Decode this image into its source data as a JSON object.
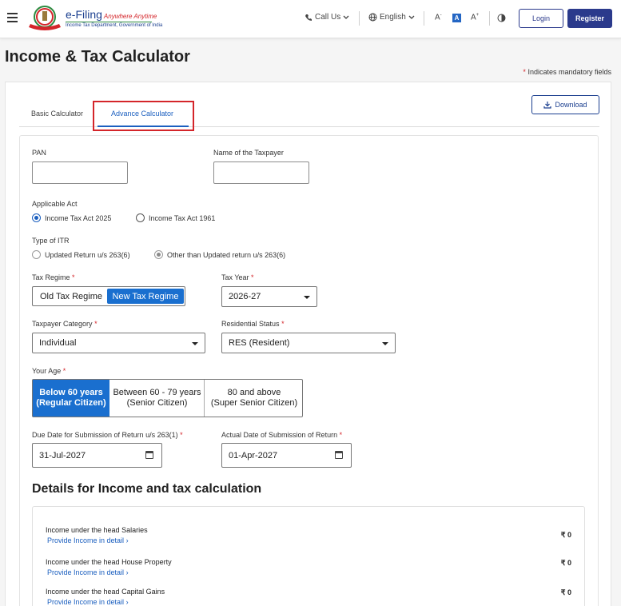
{
  "header": {
    "brand_main": "e-Filing",
    "brand_tag": "Anywhere Anytime",
    "brand_sub": "Income Tax Department, Government of India",
    "call_us": "Call Us",
    "language": "English",
    "font_small": "A",
    "font_normal": "A",
    "font_large": "A",
    "login": "Login",
    "register": "Register"
  },
  "page": {
    "title": "Income & Tax Calculator",
    "mandatory_star": "*",
    "mandatory_note": "Indicates mandatory fields",
    "download": "Download"
  },
  "tabs": [
    {
      "label": "Basic Calculator",
      "active": false
    },
    {
      "label": "Advance Calculator",
      "active": true
    }
  ],
  "form": {
    "pan_label": "PAN",
    "pan_value": "",
    "name_label": "Name of the Taxpayer",
    "name_value": "",
    "act_label": "Applicable Act",
    "act_options": [
      "Income Tax Act 2025",
      "Income Tax Act 1961"
    ],
    "act_selected": "Income Tax Act 2025",
    "itr_label": "Type of ITR",
    "itr_options": [
      "Updated Return u/s 263(6)",
      "Other than Updated return u/s 263(6)"
    ],
    "itr_selected": "Other than Updated return u/s 263(6)",
    "regime_label": "Tax Regime",
    "regime_options": [
      "Old Tax Regime",
      "New Tax Regime"
    ],
    "regime_selected": "New Tax Regime",
    "tax_year_label": "Tax Year",
    "tax_year_value": "2026-27",
    "category_label": "Taxpayer Category",
    "category_value": "Individual",
    "residential_label": "Residential Status",
    "residential_value": "RES (Resident)",
    "age_label": "Your Age",
    "age_options": [
      {
        "line1": "Below 60 years",
        "line2": "(Regular Citizen)"
      },
      {
        "line1": "Between 60 - 79 years",
        "line2": "(Senior Citizen)"
      },
      {
        "line1": "80 and above",
        "line2": "(Super Senior Citizen)"
      }
    ],
    "age_selected": "Below 60 years",
    "due_date_label": "Due Date for Submission of Return u/s 263(1)",
    "due_date_value": "31-Jul-2027",
    "actual_date_label": "Actual Date of Submission of Return",
    "actual_date_value": "01-Apr-2027",
    "required_mark": "*"
  },
  "details": {
    "title": "Details for Income and tax calculation",
    "rows": [
      {
        "label": "Income under the head Salaries",
        "link": "Provide Income in detail",
        "value": "₹ 0"
      },
      {
        "label": "Income under the head House Property",
        "link": "Provide Income in detail",
        "value": "₹ 0"
      },
      {
        "label": "Income under the head Capital Gains",
        "link": "Provide Income in detail",
        "value": "₹ 0"
      }
    ]
  },
  "colors": {
    "primary": "#2b3a8c",
    "accent_blue": "#1a6fcf",
    "highlight_red": "#d4252a"
  },
  "icons": [
    "menu-icon",
    "emblem-logo",
    "phone-icon",
    "globe-icon",
    "chevron-down-icon",
    "contrast-icon",
    "download-icon",
    "calendar-icon",
    "chevron-right-icon"
  ]
}
